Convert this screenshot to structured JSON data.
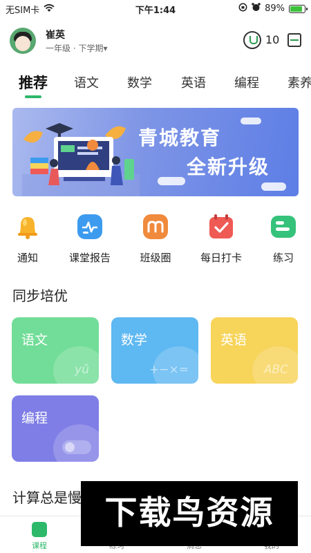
{
  "status_bar": {
    "carrier": "无SIM卡",
    "time": "下午1:44",
    "battery": "89%",
    "battery_level": 0.89
  },
  "profile": {
    "name": "崔英",
    "grade": "一年级 · 下学期▾",
    "points": "10"
  },
  "tabs": [
    "推荐",
    "语文",
    "数学",
    "英语",
    "编程",
    "素养"
  ],
  "banner": {
    "line1": "青城教育",
    "line2": "全新升级"
  },
  "quick_actions": [
    {
      "label": "通知",
      "icon": "bell-icon",
      "color": "#f7b32b"
    },
    {
      "label": "课堂报告",
      "icon": "report-icon",
      "color": "#3d9bef"
    },
    {
      "label": "班级圈",
      "icon": "class-circle-icon",
      "color": "#f08a3c"
    },
    {
      "label": "每日打卡",
      "icon": "checkin-icon",
      "color": "#ef5a55"
    },
    {
      "label": "练习",
      "icon": "practice-icon",
      "color": "#35c27a"
    }
  ],
  "sync_section": {
    "title": "同步培优",
    "cards": [
      {
        "label": "语文",
        "glyph": "yǔ",
        "color": "#72dd98"
      },
      {
        "label": "数学",
        "glyph": "+−×=",
        "color": "#5eb8f2"
      },
      {
        "label": "英语",
        "glyph": "ABC",
        "color": "#f7d45a"
      },
      {
        "label": "编程",
        "glyph": "",
        "color": "#7f7ee6"
      }
    ]
  },
  "calc_section": {
    "title": "计算总是慢"
  },
  "bottom_nav": [
    {
      "label": "课程",
      "active": true
    },
    {
      "label": "练习",
      "active": false
    },
    {
      "label": "消息",
      "active": false
    },
    {
      "label": "我的",
      "active": false
    }
  ],
  "watermark": "下载鸟资源",
  "colors": {
    "accent": "#2db86a",
    "banner_start": "#aab9ee",
    "banner_end": "#5d7ee6"
  }
}
